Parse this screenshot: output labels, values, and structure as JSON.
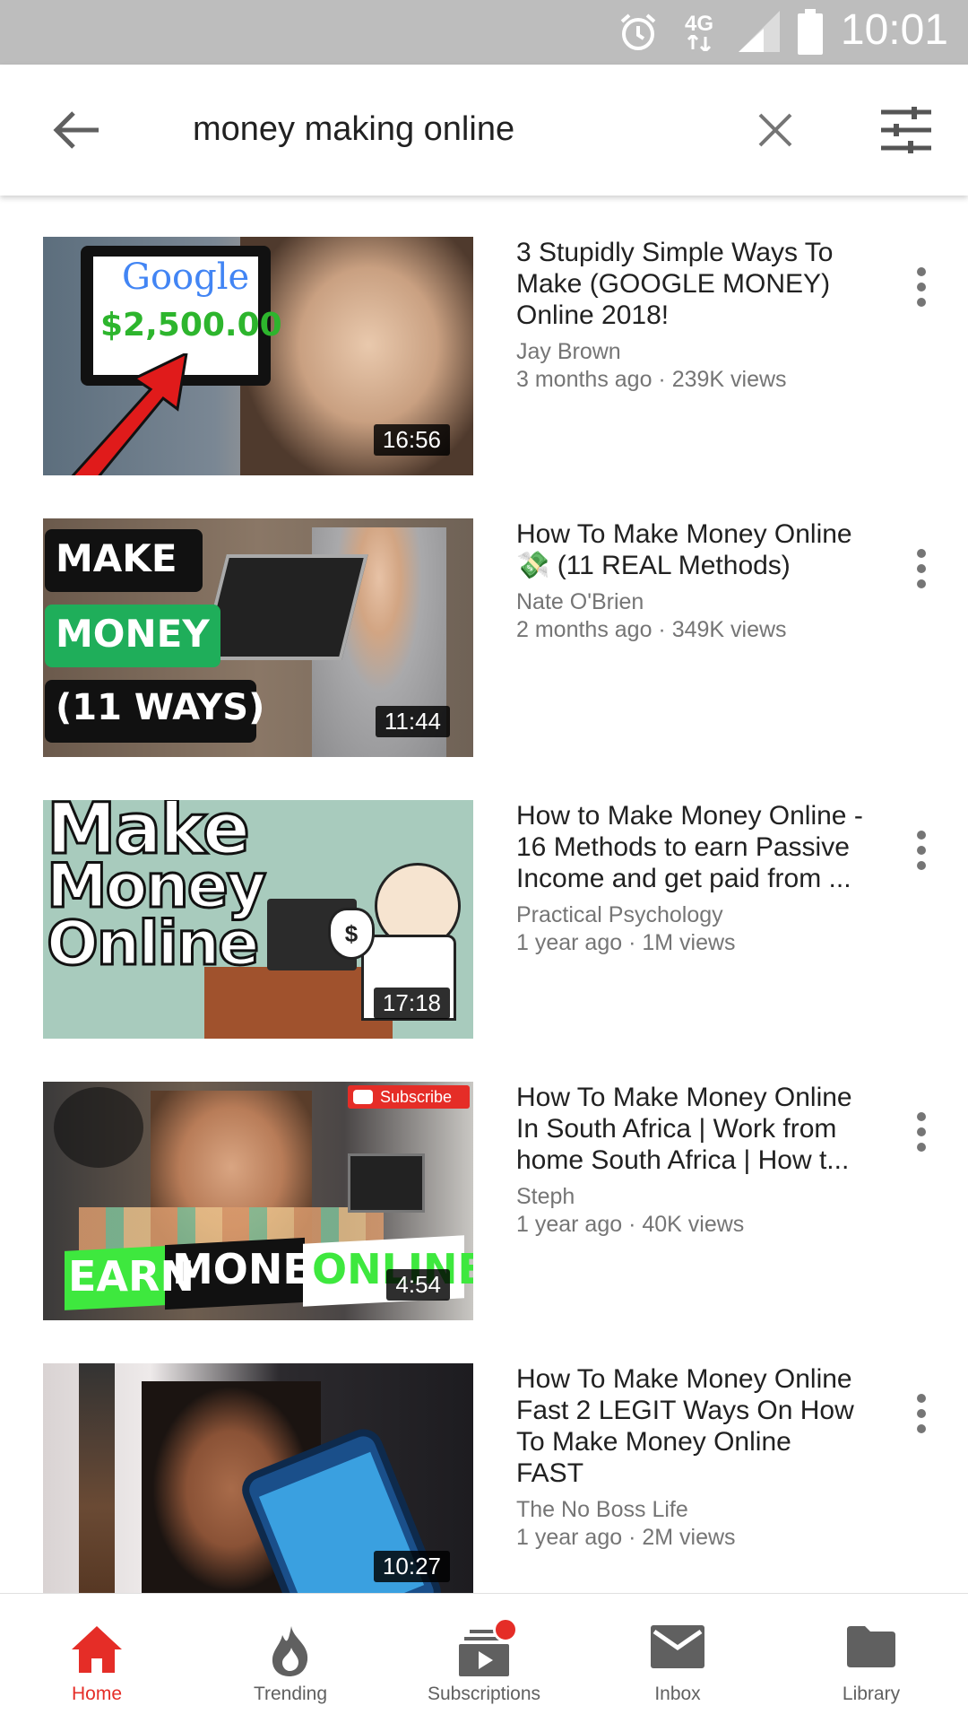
{
  "status_bar": {
    "time": "10:01",
    "network": "4G"
  },
  "search": {
    "query": "money making online"
  },
  "results": [
    {
      "title": "3 Stupidly Simple Ways To Make (GOOGLE MONEY) Online 2018!",
      "channel": "Jay Brown",
      "stats": "3 months ago · 239K views",
      "duration": "16:56",
      "thumb_text": [
        "Google",
        "$2,500.00"
      ]
    },
    {
      "title": "How To Make Money Online 💸 (11 REAL Methods)",
      "channel": "Nate O'Brien",
      "stats": "2 months ago · 349K views",
      "duration": "11:44",
      "thumb_text": [
        "MAKE",
        "MONEY",
        "(11 WAYS)"
      ]
    },
    {
      "title": "How to Make Money Online - 16 Methods to earn Passive Income and get paid from ...",
      "channel": "Practical Psychology",
      "stats": "1 year ago · 1M views",
      "duration": "17:18",
      "thumb_text": [
        "Make",
        "Money",
        "Online",
        "$"
      ]
    },
    {
      "title": "How To Make Money Online In South Africa | Work from home South Africa | How t...",
      "channel": "Steph",
      "stats": "1 year ago · 40K views",
      "duration": "4:54",
      "thumb_text": [
        "Subscribe",
        "EARN",
        "MONEY",
        "ONLINE"
      ]
    },
    {
      "title": "How To Make Money Online Fast 2 LEGIT Ways On How To Make Money Online FAST",
      "channel": "The No Boss Life",
      "stats": "1 year ago · 2M views",
      "duration": "10:27",
      "thumb_text": []
    }
  ],
  "bottom_nav": [
    {
      "label": "Home",
      "icon": "home-icon",
      "active": true
    },
    {
      "label": "Trending",
      "icon": "flame-icon",
      "active": false
    },
    {
      "label": "Subscriptions",
      "icon": "subscriptions-icon",
      "active": false,
      "badge": true
    },
    {
      "label": "Inbox",
      "icon": "mail-icon",
      "active": false
    },
    {
      "label": "Library",
      "icon": "folder-icon",
      "active": false
    }
  ],
  "colors": {
    "accent": "#e52d27",
    "status_bar": "#bdbdbd",
    "text_secondary": "#757575"
  }
}
